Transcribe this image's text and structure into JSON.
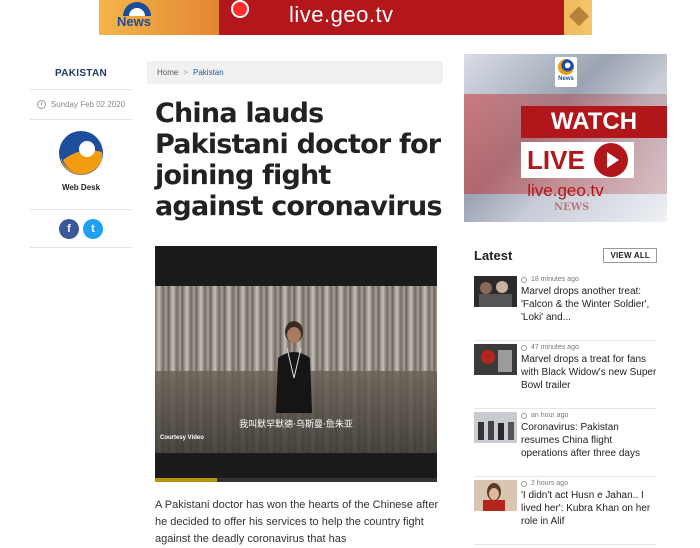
{
  "top_banner": {
    "brand": "News",
    "url": "live.geo.tv"
  },
  "article": {
    "category": "PAKISTAN",
    "date": "Sunday Feb 02 2020",
    "author": "Web Desk",
    "breadcrumb": {
      "home": "Home",
      "separator": ">",
      "section": "Pakistan"
    },
    "headline": "China lauds Pakistani doctor for joining fight against coronavirus",
    "video": {
      "subtitle": "我叫默罕默德·乌斯曼·詹朱亚",
      "courtesy": "Courtesy Video",
      "progress": 0.22
    },
    "body": "A Pakistani doctor has won the hearts of the Chinese after he decided to offer his services to help the country fight against the deadly coronavirus that has"
  },
  "share": {
    "facebook": "f",
    "twitter": "t"
  },
  "side_ad": {
    "brand": "News",
    "watch": "WATCH",
    "live": "LIVE",
    "url": "live.geo.tv",
    "watermark": "NEWS"
  },
  "latest": {
    "title": "Latest",
    "view_all": "VIEW ALL",
    "items": [
      {
        "time": "18 minutes ago",
        "title": "Marvel drops another treat: 'Falcon & the Winter Soldier', 'Loki' and..."
      },
      {
        "time": "47 minutes ago",
        "title": "Marvel drops a treat for fans with Black Widow's new Super Bowl trailer"
      },
      {
        "time": "an hour ago",
        "title": "Coronavirus: Pakistan resumes China flight operations after three days"
      },
      {
        "time": "2 hours ago",
        "title": "'I didn't act Husn e Jahan.. I lived her': Kubra Khan on her role in Alif"
      }
    ]
  },
  "colors": {
    "brand_blue": "#1b3a6b",
    "link_blue": "#1d5ea8",
    "geo_red": "#b0161a",
    "facebook": "#3b5998",
    "twitter": "#1da1f2"
  }
}
